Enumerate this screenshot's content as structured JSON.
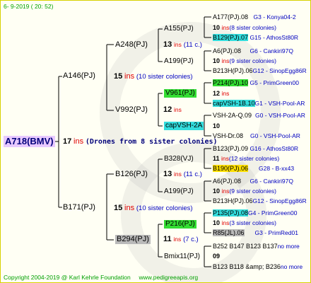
{
  "header": {
    "date": "6-  9-2019 ( 20: 52)"
  },
  "footer": {
    "copyright": "Copyright 2004-2019 @ Karl Kehrle Foundation",
    "site": "www.pedigreeapis.org"
  },
  "root": {
    "name": "A718(BMV)",
    "num": "17",
    "ins": "ins",
    "drones": "(Drones from 8 sister colonies)"
  },
  "g1": [
    {
      "name": "A146(PJ)",
      "num": "15",
      "ins": "ins",
      "note": "(10 sister colonies)"
    },
    {
      "name": "B171(PJ)",
      "num": "15",
      "ins": "ins",
      "note": "(10 sister colonies)"
    }
  ],
  "g2": [
    {
      "name": "A248(PJ)",
      "num": "13",
      "ins": "ins",
      "note": "(11 c.)"
    },
    {
      "name": "V992(PJ)",
      "num": "12",
      "ins": "ins",
      "note": ""
    },
    {
      "name": "B126(PJ)",
      "num": "13",
      "ins": "ins",
      "note": "(11 c.)"
    },
    {
      "name": "B294(PJ)",
      "num": "11",
      "ins": "ins",
      "note": "(7 c.)"
    }
  ],
  "g3": [
    {
      "name": "A155(PJ)"
    },
    {
      "name": "A199(PJ)"
    },
    {
      "name": "V961(PJ)"
    },
    {
      "name": "capVSH-2A"
    },
    {
      "name": "B328(VJ)"
    },
    {
      "name": "A199(PJ)"
    },
    {
      "name": "P216(PJ)"
    },
    {
      "name": "Bmix11(PJ)"
    }
  ],
  "g4": [
    {
      "a": "A177(PJ).08",
      "b": "G3 - Konya04-2",
      "num": "10",
      "ins": "ins",
      "note": "(8 sister colonies)",
      "c": "B129(PJ).07",
      "d": "G15 - AthosSt80R"
    },
    {
      "a": "A6(PJ).08",
      "b": "G6 - Cankiri97Q",
      "num": "10",
      "ins": "ins",
      "note": "(9 sister colonies)",
      "c": "B213H(PJ).06",
      "d": "G12 - SinopEgg86R"
    },
    {
      "a": "P214(PJ).10",
      "b": "G5 - PrimGreen00",
      "num": "12",
      "ins": "ins",
      "note": "",
      "c": "capVSH-1B.10",
      "d": "G1 - VSH-Pool-AR"
    },
    {
      "a": "VSH-2A-Q.09",
      "b": "G0 - VSH-Pool-AR",
      "num": "10",
      "ins": "",
      "note": "",
      "c": "VSH-Dr.08",
      "d": "G0 - VSH-Pool-AR"
    },
    {
      "a": "B123(PJ).09",
      "b": "G16 - AthosSt80R",
      "num": "11",
      "ins": "ins",
      "note": "(12 sister colonies)",
      "c": "B190(PJ).06",
      "d": "G28 - B-xx43"
    },
    {
      "a": "A6(PJ).08",
      "b": "G6 - Cankiri97Q",
      "num": "10",
      "ins": "ins",
      "note": "(9 sister colonies)",
      "c": "B213H(PJ).06",
      "d": "G12 - SinopEgg86R"
    },
    {
      "a": "P135(PJ).08",
      "b": "G4 - PrimGreen00",
      "num": "10",
      "ins": "ins",
      "note": "(3 sister colonies)",
      "c": "R85(JL).06",
      "d": "G3 - PrimRed01"
    },
    {
      "a": "B252 B147 B123 B137",
      "b": "no more",
      "num": "09",
      "ins": "",
      "note": "",
      "c": "B123 B118 &amp; B236",
      "d": "no more"
    }
  ]
}
